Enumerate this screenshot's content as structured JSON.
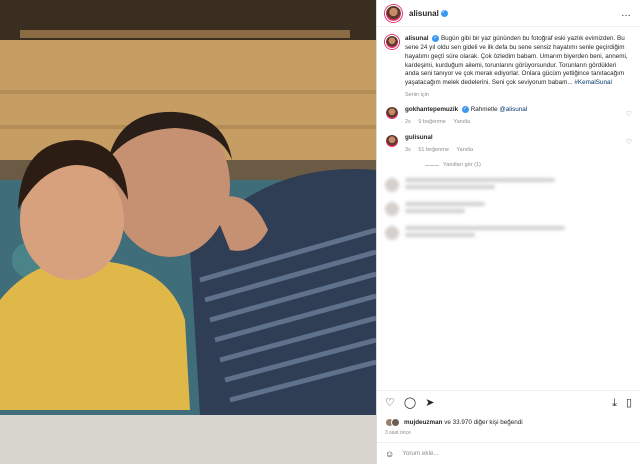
{
  "post": {
    "username": "alisunal",
    "more_icon": "…"
  },
  "caption": {
    "username": "alisunal",
    "text": "Bugün gibi bir yaz gününden bu fotoğraf eski yazlık evimizden. Bu sene 24 yıl oldu sen gideli ve ilk defa bu sene sensiz hayatımı senle geçirdiğim hayatımı geçti süre olarak. Çok özledim babam. Umarım biyerden beni, annemi, kardeşimi, kurduğum ailemi, torunlarını görüyorsundur. Torunların gördükleri anda seni tanıyor ve çok merak ediyorlar. Onlara gücüm yettiğince tanıtacağım yaşatacağım melek dedelerini. Seni çok seviyorum babam...",
    "hashtag": "#KemalSunal",
    "translate": "Senin için"
  },
  "comments": [
    {
      "username": "gokhantepemuzik",
      "text": "Rahmetle",
      "mention": "@alisunal",
      "time": "2s",
      "likes": "9 beğenme",
      "reply": "Yanıtla"
    },
    {
      "username": "gulisunal",
      "text": "",
      "time": "3s",
      "likes": "51 beğenme",
      "reply": "Yanıtla"
    }
  ],
  "view_replies": "Yanıtları gör (1)",
  "likes_line": {
    "user": "mujdeuzman",
    "rest": "ve 33.970 diğer kişi beğendi"
  },
  "time_ago": "3 saat önce",
  "add_comment_placeholder": "Yorum ekle..."
}
